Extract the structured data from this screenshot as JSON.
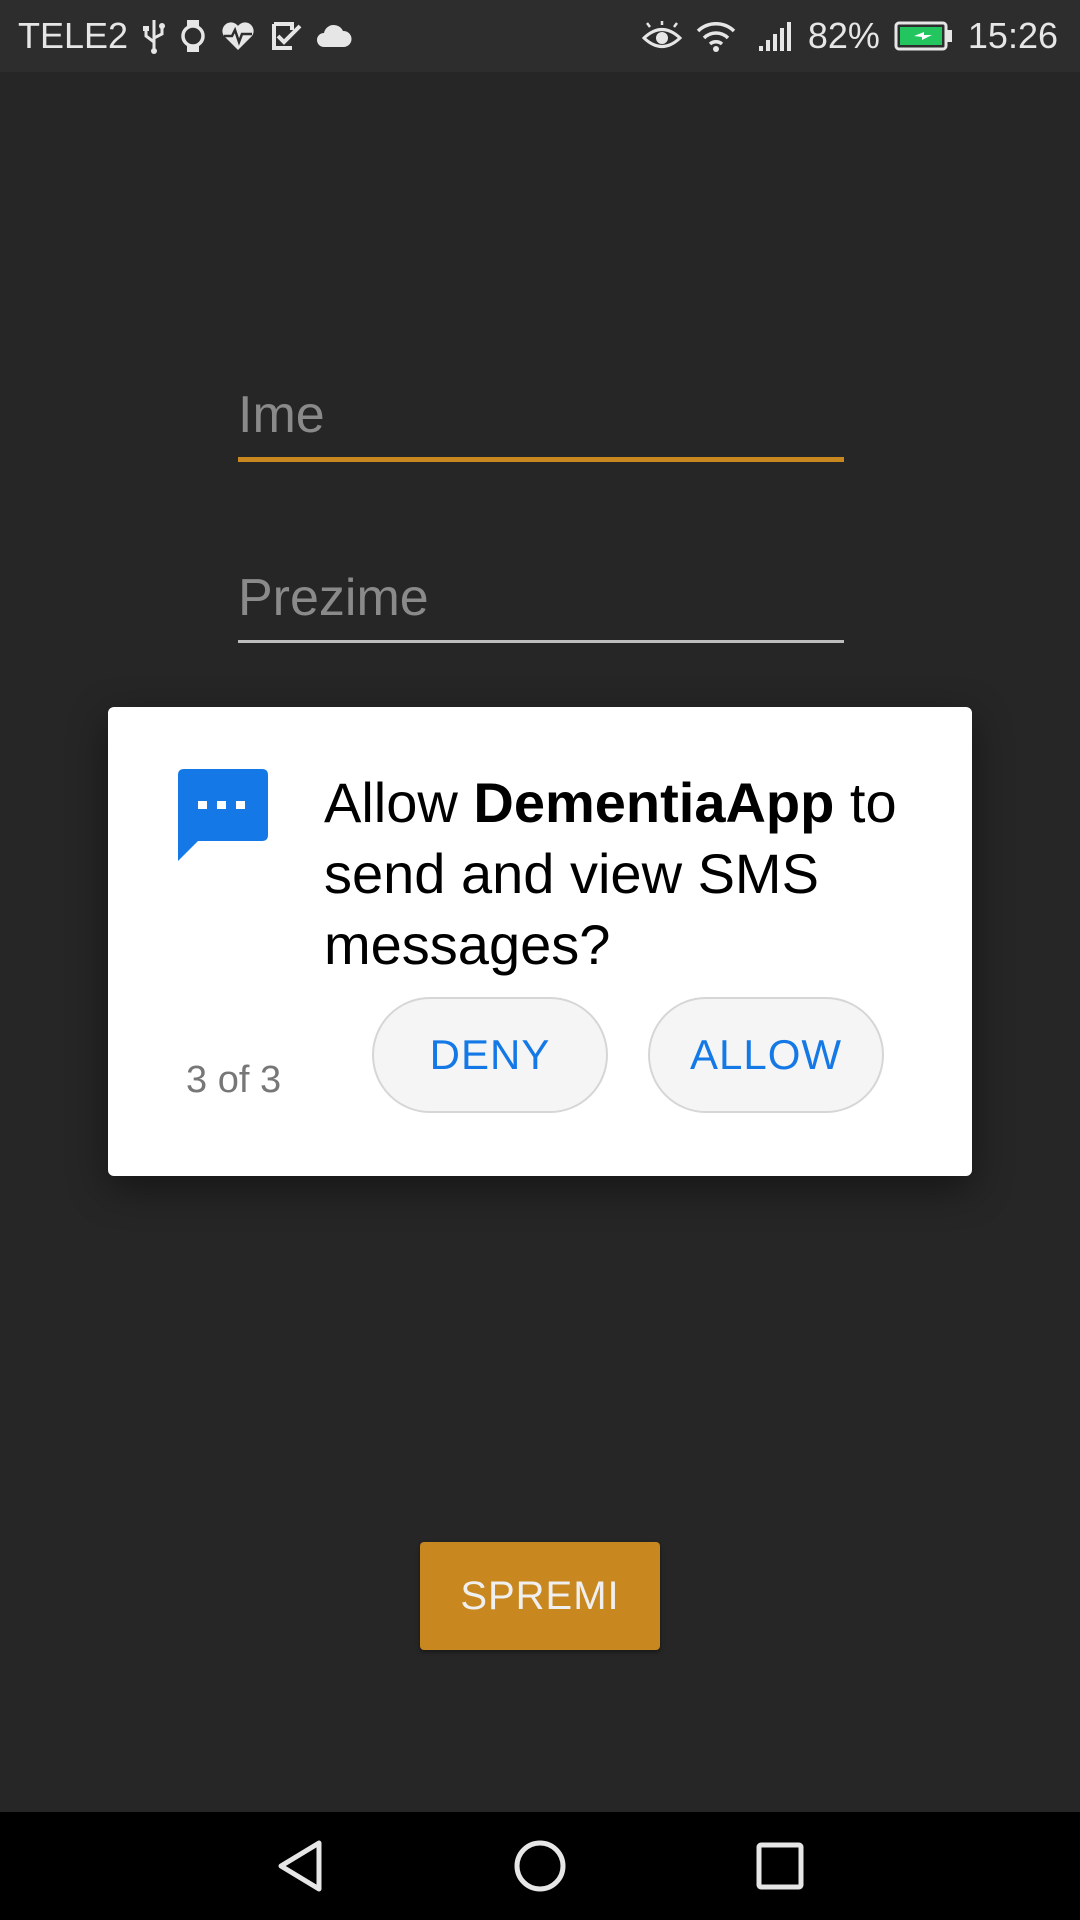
{
  "status_bar": {
    "carrier": "TELE2",
    "battery_percent": "82%",
    "time": "15:26",
    "left_icons": [
      "usb-icon",
      "watch-icon",
      "heart-rate-icon",
      "task-check-icon",
      "cloud-icon"
    ],
    "right_icons": [
      "eye-comfort-icon",
      "wifi-icon",
      "signal-icon",
      "battery-charging-icon"
    ]
  },
  "form": {
    "first_name_placeholder": "Ime",
    "last_name_placeholder": "Prezime",
    "save_label": "SPREMI"
  },
  "dialog": {
    "icon": "sms-message-icon",
    "message_prefix": "Allow ",
    "app_name": "DementiaApp",
    "message_suffix": " to send and view SMS messages?",
    "counter": "3 of 3",
    "deny_label": "DENY",
    "allow_label": "ALLOW"
  },
  "nav_bar": {
    "icons": [
      "back-icon",
      "home-icon",
      "recents-icon"
    ]
  },
  "colors": {
    "background": "#262626",
    "accent": "#c8871f",
    "dialog_button_text": "#1479e6"
  }
}
